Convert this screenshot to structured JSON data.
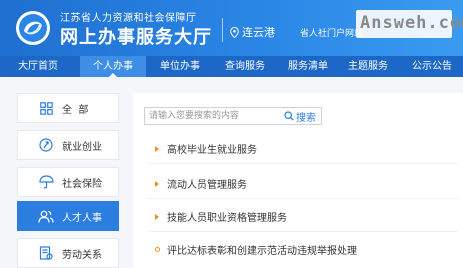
{
  "header": {
    "org_name": "江苏省人力资源和社会保障厅",
    "hall_title": "网上办事服务大厅",
    "location": "连云港",
    "portal_link": "省人社门户网站",
    "watermark": "Answeh.com"
  },
  "nav": {
    "items": [
      {
        "label": "大厅首页"
      },
      {
        "label": "个人办事"
      },
      {
        "label": "单位办事"
      },
      {
        "label": "查询服务"
      },
      {
        "label": "服务清单"
      },
      {
        "label": "主题服务"
      },
      {
        "label": "公示公告"
      }
    ],
    "active_index": 1
  },
  "sidebar": {
    "items": [
      {
        "label": "全  部",
        "icon": "grid-icon"
      },
      {
        "label": "就业创业",
        "icon": "employment-icon"
      },
      {
        "label": "社会保险",
        "icon": "umbrella-icon"
      },
      {
        "label": "人才人事",
        "icon": "people-icon"
      },
      {
        "label": "劳动关系",
        "icon": "contract-icon"
      }
    ],
    "active_index": 3
  },
  "search": {
    "placeholder": "请输入您要搜索的内容",
    "button_label": "搜索"
  },
  "services": [
    {
      "label": "高校毕业生就业服务"
    },
    {
      "label": "流动人员管理服务"
    },
    {
      "label": "技能人员职业资格管理服务"
    },
    {
      "label": "评比达标表彰和创建示范活动违规举报处理"
    }
  ],
  "colors": {
    "header_blue": "#2a86e6",
    "nav_blue": "#1d67c6",
    "active_blue": "#2c7de0",
    "bullet_orange": "#f08a24"
  }
}
